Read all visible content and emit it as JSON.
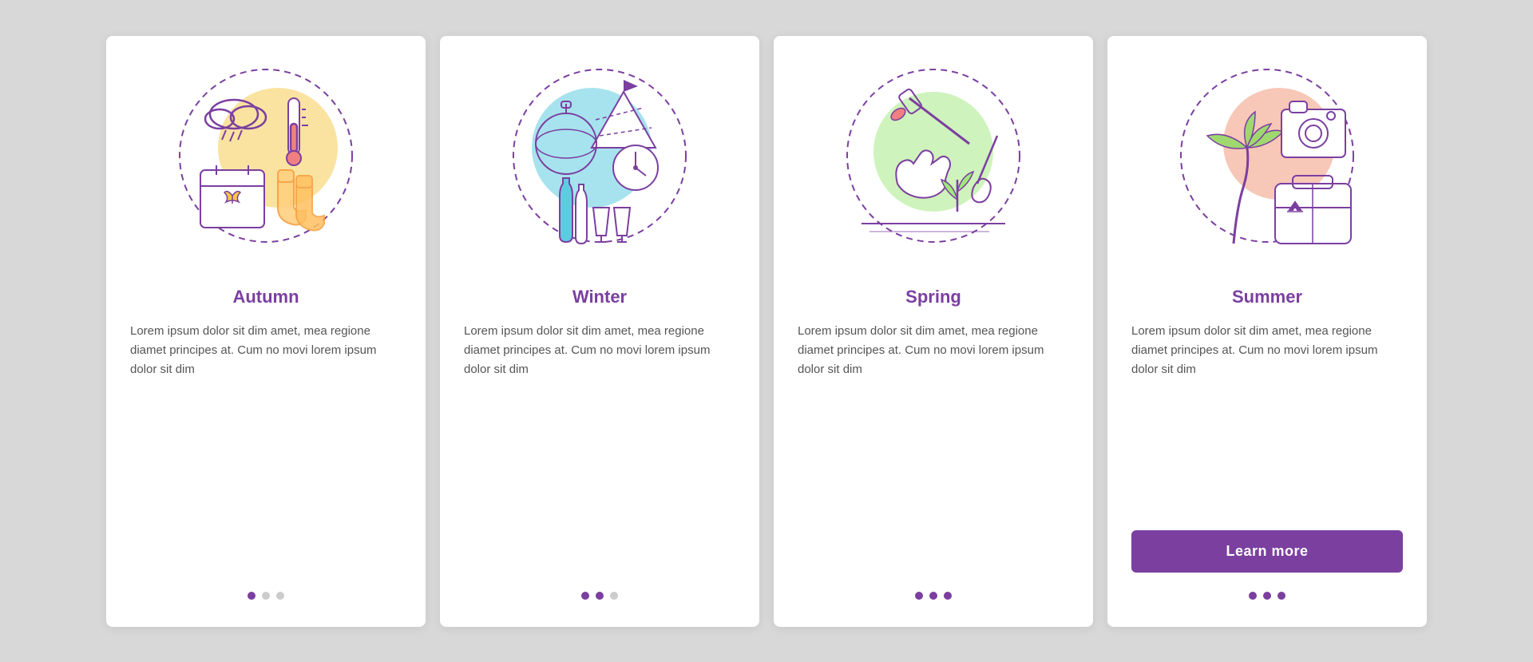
{
  "cards": [
    {
      "id": "autumn",
      "title": "Autumn",
      "body": "Lorem ipsum dolor sit dim amet, mea regione diamet principes at. Cum no movi lorem ipsum dolor sit dim",
      "accent_color": "#f5c842",
      "dots": [
        true,
        false,
        false
      ],
      "show_button": false,
      "button_label": ""
    },
    {
      "id": "winter",
      "title": "Winter",
      "body": "Lorem ipsum dolor sit dim amet, mea regione diamet principes at. Cum no movi lorem ipsum dolor sit dim",
      "accent_color": "#5ecce0",
      "dots": [
        true,
        true,
        false
      ],
      "show_button": false,
      "button_label": ""
    },
    {
      "id": "spring",
      "title": "Spring",
      "body": "Lorem ipsum dolor sit dim amet, mea regione diamet principes at. Cum no movi lorem ipsum dolor sit dim",
      "accent_color": "#a0e87a",
      "dots": [
        true,
        true,
        true
      ],
      "show_button": false,
      "button_label": ""
    },
    {
      "id": "summer",
      "title": "Summer",
      "body": "Lorem ipsum dolor sit dim amet, mea regione diamet principes at. Cum no movi lorem ipsum dolor sit dim",
      "accent_color": "#f09070",
      "dots": [
        true,
        true,
        true
      ],
      "show_button": true,
      "button_label": "Learn more"
    }
  ],
  "dot_active_color": "#7b3fa0",
  "dot_inactive_color": "#cccccc"
}
